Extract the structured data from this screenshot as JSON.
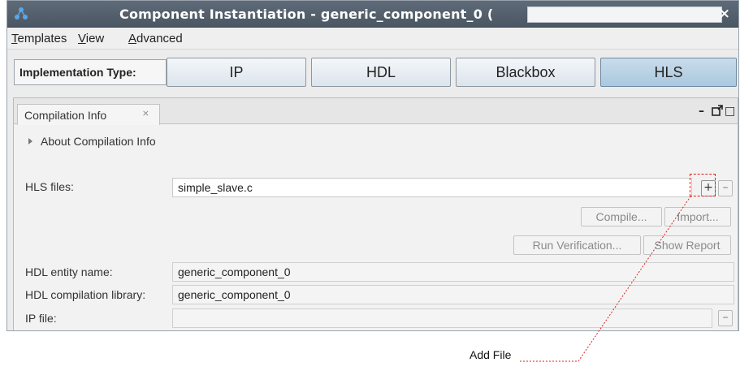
{
  "window": {
    "title": "Component Instantiation - generic_component_0 (",
    "close_glyph": "×"
  },
  "menu": [
    {
      "first": "T",
      "rest": "emplates"
    },
    {
      "first": "V",
      "rest": "iew"
    },
    {
      "first": "A",
      "rest": "dvanced"
    }
  ],
  "implementation": {
    "label": "Implementation Type:",
    "buttons": [
      "IP",
      "HDL",
      "Blackbox",
      "HLS"
    ],
    "active": "HLS"
  },
  "tab": {
    "label": "Compilation Info",
    "close_glyph": "⨯"
  },
  "panel_controls": [
    "–",
    "□"
  ],
  "about": "About Compilation Info",
  "hls_files": {
    "label": "HLS files:",
    "value": "simple_slave.c",
    "add": "+",
    "remove": "–"
  },
  "actions": {
    "compile": "Compile...",
    "import": "Import...",
    "run_verification": "Run Verification...",
    "show_report": "Show Report"
  },
  "hdl_entity": {
    "label": "HDL entity name:",
    "value": "generic_component_0"
  },
  "hdl_library": {
    "label": "HDL compilation library:",
    "value": "generic_component_0"
  },
  "ip_file": {
    "label": "IP file:",
    "value": "",
    "remove": "–"
  },
  "callout": {
    "text": "Add File",
    "color": "#d22222"
  },
  "colors": {
    "titlebar": "#56616e",
    "active_impl": "#b7d0e4"
  }
}
